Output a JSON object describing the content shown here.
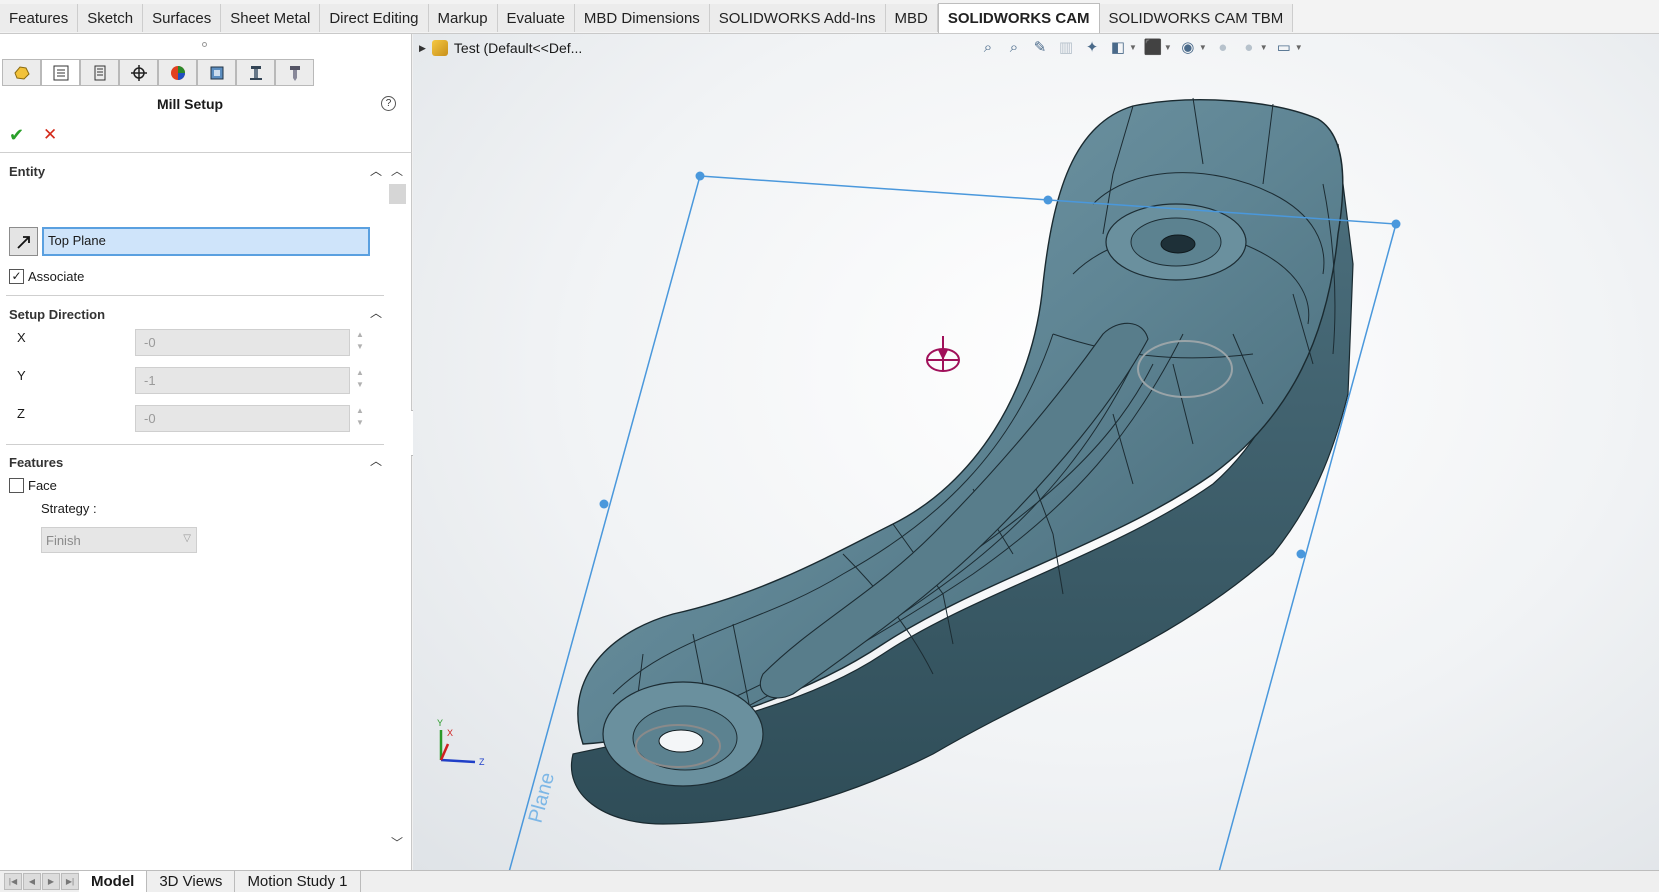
{
  "ribbon": {
    "tabs": [
      {
        "label": "Features"
      },
      {
        "label": "Sketch"
      },
      {
        "label": "Surfaces"
      },
      {
        "label": "Sheet Metal"
      },
      {
        "label": "Direct Editing"
      },
      {
        "label": "Markup"
      },
      {
        "label": "Evaluate"
      },
      {
        "label": "MBD Dimensions"
      },
      {
        "label": "SOLIDWORKS Add-Ins"
      },
      {
        "label": "MBD"
      },
      {
        "label": "SOLIDWORKS CAM"
      },
      {
        "label": "SOLIDWORKS CAM TBM"
      }
    ],
    "active": "SOLIDWORKS CAM"
  },
  "manager_tabs": [
    {
      "icon": "part-icon"
    },
    {
      "icon": "property-manager-icon"
    },
    {
      "icon": "configuration-manager-icon"
    },
    {
      "icon": "dimxpert-icon"
    },
    {
      "icon": "display-manager-icon"
    },
    {
      "icon": "cam-feature-tree-icon"
    },
    {
      "icon": "cam-operation-tree-icon"
    },
    {
      "icon": "cam-tool-tree-icon"
    }
  ],
  "property_manager": {
    "title": "Mill Setup",
    "help": "?",
    "ok": "✔",
    "cancel": "✕",
    "entity": {
      "heading": "Entity",
      "value": "Top Plane",
      "associate_label": "Associate",
      "associate_checked": true
    },
    "setup_direction": {
      "heading": "Setup Direction",
      "x_label": "X",
      "x_value": "-0",
      "y_label": "Y",
      "y_value": "-1",
      "z_label": "Z",
      "z_value": "-0"
    },
    "features": {
      "heading": "Features",
      "face_label": "Face",
      "face_checked": false,
      "strategy_label": "Strategy :",
      "strategy_value": "Finish"
    }
  },
  "viewport": {
    "tree_label": "Test  (Default<<Def...",
    "plane_label": "Plane",
    "triad": {
      "x": "X",
      "y": "Y",
      "z": "Z"
    },
    "part_color": "#5f8594",
    "plane_color": "#4a98dc",
    "origin_color": "#a0105a"
  },
  "bottom_tabs": [
    {
      "label": "Model"
    },
    {
      "label": "3D Views"
    },
    {
      "label": "Motion Study 1"
    }
  ],
  "bottom_active": "Model"
}
